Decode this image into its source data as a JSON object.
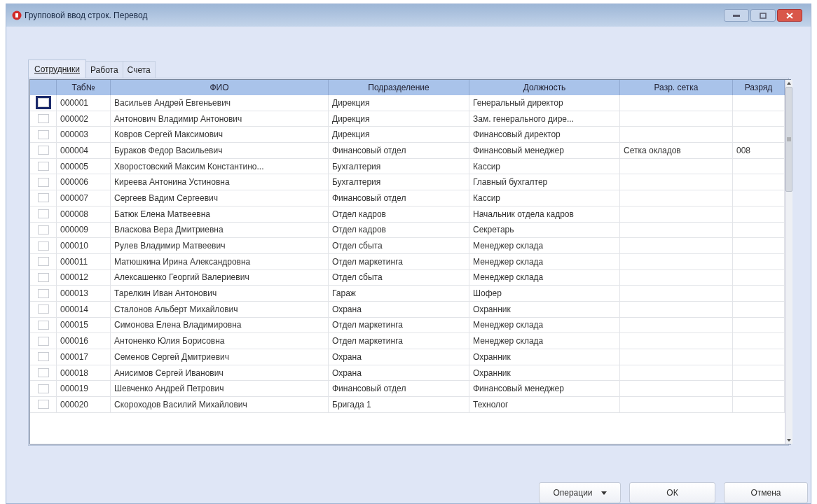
{
  "window": {
    "title": "Групповой ввод строк. Перевод"
  },
  "tabs": [
    {
      "label": "Сотрудники",
      "selected": true
    },
    {
      "label": "Работа",
      "selected": false
    },
    {
      "label": "Счета",
      "selected": false
    }
  ],
  "table": {
    "columns": [
      "Таб№",
      "ФИО",
      "Подразделение",
      "Должность",
      "Разр. сетка",
      "Разряд"
    ],
    "rows": [
      {
        "checked": false,
        "current": true,
        "cells": [
          "000001",
          "Васильев Андрей Евгеньевич",
          "Дирекция",
          "Генеральный директор",
          "",
          ""
        ]
      },
      {
        "checked": false,
        "current": false,
        "cells": [
          "000002",
          "Антонович Владимир Антонович",
          "Дирекция",
          "Зам. генерального дире...",
          "",
          ""
        ]
      },
      {
        "checked": false,
        "current": false,
        "cells": [
          "000003",
          "Ковров Сергей Максимович",
          "Дирекция",
          "Финансовый директор",
          "",
          ""
        ]
      },
      {
        "checked": false,
        "current": false,
        "cells": [
          "000004",
          "Бураков Федор Васильевич",
          "Финансовый отдел",
          "Финансовый менеджер",
          "Сетка окладов",
          "008"
        ]
      },
      {
        "checked": false,
        "current": false,
        "cells": [
          "000005",
          "Хворостовский Максим Константино...",
          "Бухгалтерия",
          "Кассир",
          "",
          ""
        ]
      },
      {
        "checked": false,
        "current": false,
        "cells": [
          "000006",
          "Киреева Антонина Устиновна",
          "Бухгалтерия",
          "Главный бухгалтер",
          "",
          ""
        ]
      },
      {
        "checked": false,
        "current": false,
        "cells": [
          "000007",
          "Сергеев Вадим Сергеевич",
          "Финансовый отдел",
          "Кассир",
          "",
          ""
        ]
      },
      {
        "checked": false,
        "current": false,
        "cells": [
          "000008",
          "Батюк Елена Матвеевна",
          "Отдел кадров",
          "Начальник отдела кадров",
          "",
          ""
        ]
      },
      {
        "checked": false,
        "current": false,
        "cells": [
          "000009",
          "Власкова Вера Дмитриевна",
          "Отдел кадров",
          "Секретарь",
          "",
          ""
        ]
      },
      {
        "checked": false,
        "current": false,
        "cells": [
          "000010",
          "Рулев Владимир Матвеевич",
          "Отдел сбыта",
          "Менеджер склада",
          "",
          ""
        ]
      },
      {
        "checked": false,
        "current": false,
        "cells": [
          "000011",
          "Матюшкина Ирина Александровна",
          "Отдел маркетинга",
          "Менеджер склада",
          "",
          ""
        ]
      },
      {
        "checked": false,
        "current": false,
        "cells": [
          "000012",
          "Алексашенко Георгий Валериевич",
          "Отдел сбыта",
          "Менеджер склада",
          "",
          ""
        ]
      },
      {
        "checked": false,
        "current": false,
        "cells": [
          "000013",
          "Тарелкин Иван Антонович",
          "Гараж",
          "Шофер",
          "",
          ""
        ]
      },
      {
        "checked": false,
        "current": false,
        "cells": [
          "000014",
          "Сталонов Альберт Михайлович",
          "Охрана",
          "Охранник",
          "",
          ""
        ]
      },
      {
        "checked": false,
        "current": false,
        "cells": [
          "000015",
          "Симонова Елена Владимировна",
          "Отдел маркетинга",
          "Менеджер склада",
          "",
          ""
        ]
      },
      {
        "checked": false,
        "current": false,
        "cells": [
          "000016",
          "Антоненко Юлия Борисовна",
          "Отдел маркетинга",
          "Менеджер склада",
          "",
          ""
        ]
      },
      {
        "checked": false,
        "current": false,
        "cells": [
          "000017",
          "Семенов Сергей Дмитриевич",
          "Охрана",
          "Охранник",
          "",
          ""
        ]
      },
      {
        "checked": false,
        "current": false,
        "cells": [
          "000018",
          "Анисимов Сергей Иванович",
          "Охрана",
          "Охранник",
          "",
          ""
        ]
      },
      {
        "checked": false,
        "current": false,
        "cells": [
          "000019",
          "Шевченко Андрей Петрович",
          "Финансовый отдел",
          "Финансовый менеджер",
          "",
          ""
        ]
      },
      {
        "checked": false,
        "current": false,
        "cells": [
          "000020",
          "Скороходов Василий Михайлович",
          "Бригада 1",
          "Технолог",
          "",
          ""
        ]
      }
    ]
  },
  "buttons": [
    {
      "label": "Операции",
      "kind": "dropdown"
    },
    {
      "label": "ОК",
      "kind": "plain"
    },
    {
      "label": "Отмена",
      "kind": "plain"
    }
  ]
}
